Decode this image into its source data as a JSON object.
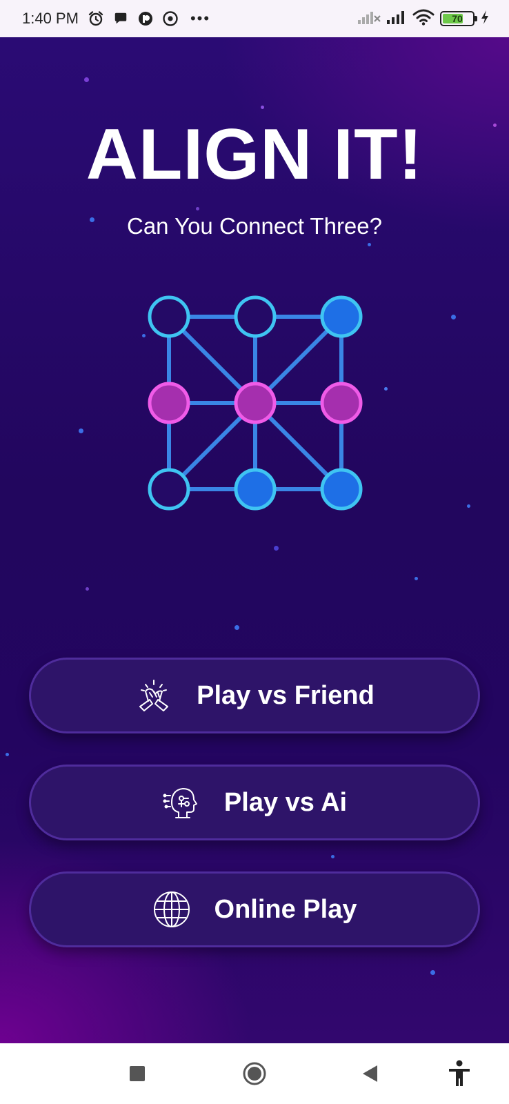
{
  "status_bar": {
    "time": "1:40 PM",
    "battery_percent": "70",
    "battery_level": 0.7,
    "icons": [
      "alarm-icon",
      "chat-bubble-icon",
      "app-notification-icon",
      "record-icon",
      "more-notifications-icon",
      "no-signal-icon",
      "signal-icon",
      "wifi-icon",
      "battery-icon",
      "charging-icon"
    ]
  },
  "app": {
    "title": "ALIGN IT!",
    "subtitle": "Can You Connect Three?",
    "colors": {
      "background_top": "#2a0b74",
      "background_bottom": "#32076e",
      "button_fill": "#2e1469",
      "button_border": "#4f2c9c",
      "node_cyan": "#3fc4f2",
      "node_blue_fill": "#1e6fe6",
      "node_pink": "#f05be8",
      "node_magenta_fill": "#a52fae",
      "line_color": "#3a86e6"
    },
    "board": {
      "nodes": [
        {
          "row": 0,
          "col": 0,
          "state": "empty"
        },
        {
          "row": 0,
          "col": 1,
          "state": "empty"
        },
        {
          "row": 0,
          "col": 2,
          "state": "blue"
        },
        {
          "row": 1,
          "col": 0,
          "state": "pink"
        },
        {
          "row": 1,
          "col": 1,
          "state": "pink"
        },
        {
          "row": 1,
          "col": 2,
          "state": "pink"
        },
        {
          "row": 2,
          "col": 0,
          "state": "empty"
        },
        {
          "row": 2,
          "col": 1,
          "state": "blue"
        },
        {
          "row": 2,
          "col": 2,
          "state": "blue"
        }
      ]
    },
    "buttons": [
      {
        "label": "Play vs Friend",
        "icon": "handshake-icon"
      },
      {
        "label": "Play vs Ai",
        "icon": "ai-robot-head-icon"
      },
      {
        "label": "Online Play",
        "icon": "globe-icon"
      }
    ]
  },
  "nav_bar": {
    "icons": [
      "recents-square-icon",
      "home-circle-icon",
      "back-triangle-icon",
      "accessibility-icon"
    ]
  }
}
